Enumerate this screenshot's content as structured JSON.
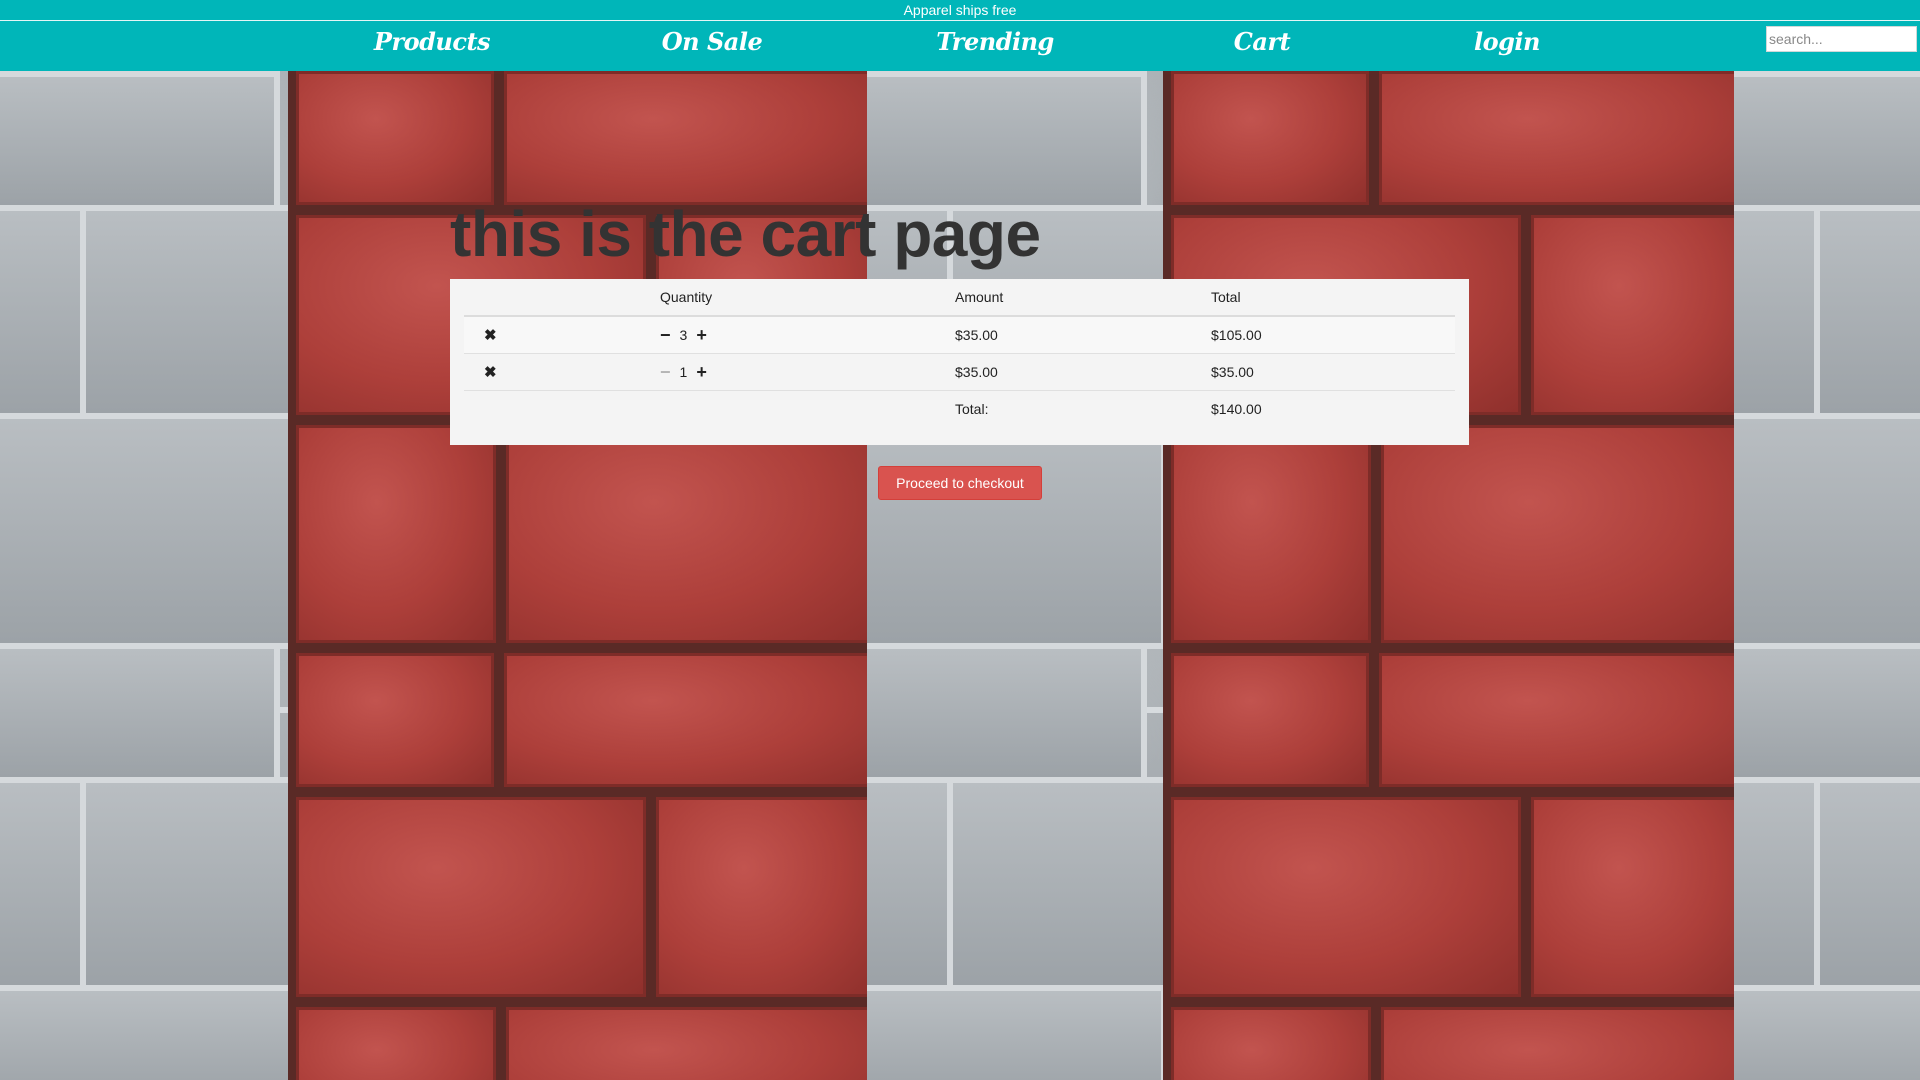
{
  "banner": {
    "text": "Apparel ships free"
  },
  "nav": {
    "links": [
      {
        "label": "Products"
      },
      {
        "label": "On Sale"
      },
      {
        "label": "Trending"
      },
      {
        "label": "Cart"
      },
      {
        "label": "login"
      }
    ],
    "search": {
      "placeholder": "search...",
      "value": ""
    }
  },
  "page": {
    "title": "this is the cart page"
  },
  "cart": {
    "headers": {
      "remove": "",
      "quantity": "Quantity",
      "amount": "Amount",
      "total": "Total"
    },
    "rows": [
      {
        "remove_icon": "✖",
        "quantity": "3",
        "amount": "$35.00",
        "total": "$105.00"
      },
      {
        "remove_icon": "✖",
        "quantity": "1",
        "amount": "$35.00",
        "total": "$35.00"
      }
    ],
    "summary": {
      "label": "Total:",
      "value": "$140.00"
    },
    "minus_icon": "−",
    "plus_icon": "+"
  },
  "checkout": {
    "label": "Proceed to checkout"
  },
  "colors": {
    "nav_bg": "#00b6b9",
    "checkout_bg": "#d9534f",
    "panel_bg": "#f4f4f4"
  },
  "icons": {
    "remove": "close-icon",
    "decrease": "minus-icon",
    "increase": "plus-icon"
  }
}
